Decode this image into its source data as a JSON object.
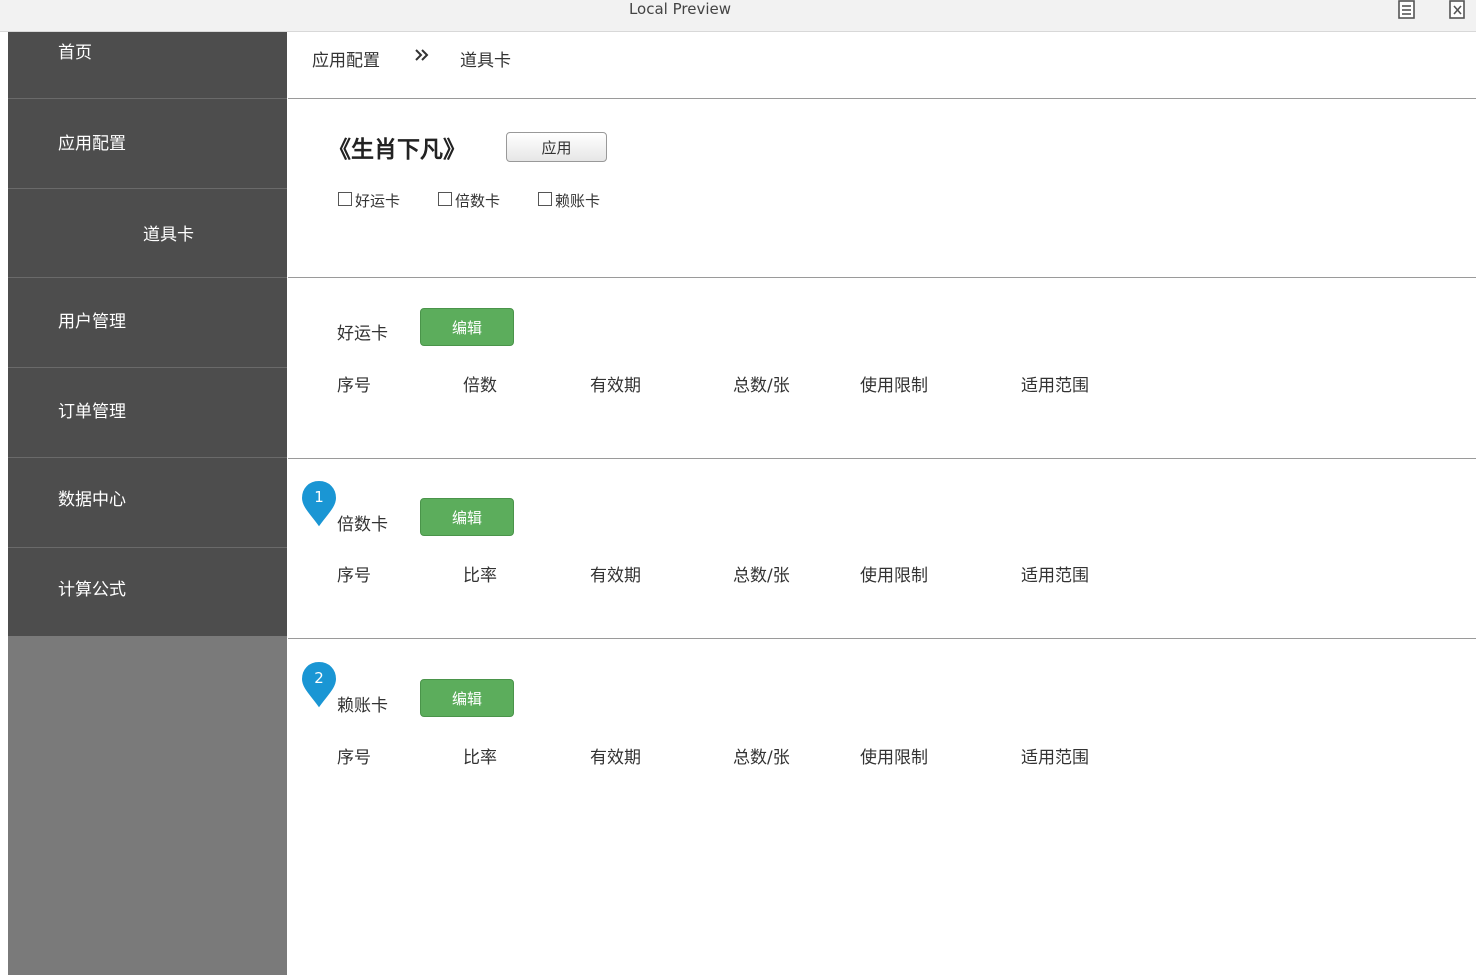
{
  "window": {
    "title": "Local Preview"
  },
  "sidebar": {
    "items": [
      {
        "label": "首页"
      },
      {
        "label": "应用配置"
      },
      {
        "label": "道具卡"
      },
      {
        "label": "用户管理"
      },
      {
        "label": "订单管理"
      },
      {
        "label": "数据中心"
      },
      {
        "label": "计算公式"
      }
    ]
  },
  "breadcrumb": {
    "first": "应用配置",
    "second": "道具卡"
  },
  "app": {
    "title": "《生肖下凡》",
    "apply_label": "应用",
    "checkboxes": [
      {
        "label": "好运卡",
        "checked": false
      },
      {
        "label": "倍数卡",
        "checked": false
      },
      {
        "label": "赖账卡",
        "checked": false
      }
    ]
  },
  "sections": [
    {
      "label": "好运卡",
      "edit_label": "编辑",
      "columns": [
        "序号",
        "倍数",
        "有效期",
        "总数/张",
        "使用限制",
        "适用范围"
      ]
    },
    {
      "label": "倍数卡",
      "edit_label": "编辑",
      "marker": "1",
      "columns": [
        "序号",
        "比率",
        "有效期",
        "总数/张",
        "使用限制",
        "适用范围"
      ]
    },
    {
      "label": "赖账卡",
      "edit_label": "编辑",
      "marker": "2",
      "columns": [
        "序号",
        "比率",
        "有效期",
        "总数/张",
        "使用限制",
        "适用范围"
      ]
    }
  ],
  "colors": {
    "sidebar_item": "#4d4d4d",
    "sidebar_bg": "#7a7a7a",
    "edit_button": "#5cad5c",
    "marker": "#1a96d4"
  }
}
